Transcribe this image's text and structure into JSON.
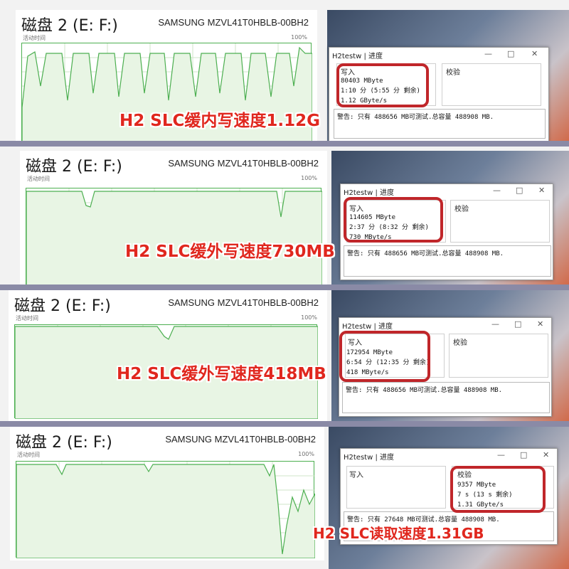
{
  "colors": {
    "accent_red": "#e0271e",
    "box_red": "#c0262a",
    "graph_green": "#4caf50",
    "graph_fill": "#e8f5e4"
  },
  "panels": [
    {
      "disk_title": "磁盘 2 (E: F:)",
      "disk_model": "SAMSUNG MZVL41T0HBLB-00BH2",
      "activity_label": "活动时间",
      "percent_label": "100%",
      "caption": "H2 SLC缓内写速度1.12G",
      "window": {
        "title": "H2testw | 进度",
        "minimize": "—",
        "maximize": "□",
        "close": "✕",
        "write_label": "写入",
        "verify_label": "校验",
        "write_stats": [
          "80403 MByte",
          "1:10 分 (5:55 分 剩余)",
          "1.12 GByte/s"
        ],
        "verify_stats": [],
        "log": "警告: 只有 488656 MB可测试.总容量 488908 MB."
      }
    },
    {
      "disk_title": "磁盘 2 (E: F:)",
      "disk_model": "SAMSUNG MZVL41T0HBLB-00BH2",
      "activity_label": "活动时间",
      "percent_label": "100%",
      "caption": "H2 SLC缓外写速度730MB",
      "window": {
        "title": "H2testw | 进度",
        "minimize": "—",
        "maximize": "□",
        "close": "✕",
        "write_label": "写入",
        "verify_label": "校验",
        "write_stats": [
          "114605 MByte",
          "2:37 分 (8:32 分 剩余)",
          "730 MByte/s"
        ],
        "verify_stats": [],
        "log": "警告: 只有 488656 MB可测试.总容量 488908 MB."
      }
    },
    {
      "disk_title": "磁盘 2 (E: F:)",
      "disk_model": "SAMSUNG MZVL41T0HBLB-00BH2",
      "activity_label": "活动时间",
      "percent_label": "100%",
      "caption": "H2 SLC缓外写速度418MB",
      "window": {
        "title": "H2testw | 进度",
        "minimize": "—",
        "maximize": "□",
        "close": "✕",
        "write_label": "写入",
        "verify_label": "校验",
        "write_stats": [
          "172954 MByte",
          "6:54 分 (12:35 分 剩余)",
          "418 MByte/s"
        ],
        "verify_stats": [],
        "log": "警告: 只有 488656 MB可测试.总容量 488908 MB."
      }
    },
    {
      "disk_title": "磁盘 2 (E: F:)",
      "disk_model": "SAMSUNG MZVL41T0HBLB-00BH2",
      "activity_label": "活动时间",
      "percent_label": "100%",
      "caption": "H2 SLC读取速度1.31GB",
      "window": {
        "title": "H2testw | 进度",
        "minimize": "—",
        "maximize": "□",
        "close": "✕",
        "write_label": "写入",
        "verify_label": "校验",
        "write_stats": [],
        "verify_stats": [
          "9357 MByte",
          "7 s (13 s 剩余)",
          "1.31 GByte/s"
        ],
        "log": "警告: 只有 27648 MB可测试.总容量 488908 MB."
      }
    }
  ]
}
